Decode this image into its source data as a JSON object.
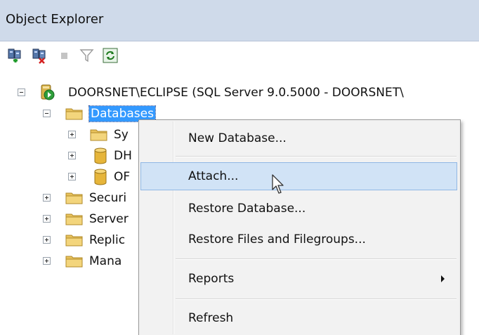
{
  "window": {
    "title": "Object Explorer"
  },
  "toolbar": {
    "buttons": [
      {
        "icon": "connect-icon"
      },
      {
        "icon": "disconnect-icon"
      },
      {
        "icon": "stop-icon"
      },
      {
        "icon": "filter-icon"
      },
      {
        "icon": "refresh-icon"
      }
    ]
  },
  "tree": {
    "server": "DOORSNET\\ECLIPSE (SQL Server 9.0.5000 - DOORSNET\\",
    "databases": "Databases",
    "children": [
      "Sy",
      "DH",
      "OF"
    ],
    "folders": [
      "Securi",
      "Server",
      "Replic",
      "Mana"
    ]
  },
  "context_menu": {
    "items": [
      "New Database...",
      "Attach...",
      "Restore Database...",
      "Restore Files and Filegroups...",
      "Reports",
      "Refresh"
    ],
    "highlighted": "Attach..."
  },
  "colors": {
    "title_bar": "#cfdaea",
    "selection": "#3399ff",
    "menu_hover": "#d1e3f6",
    "menu_background": "#f2f2f2"
  }
}
